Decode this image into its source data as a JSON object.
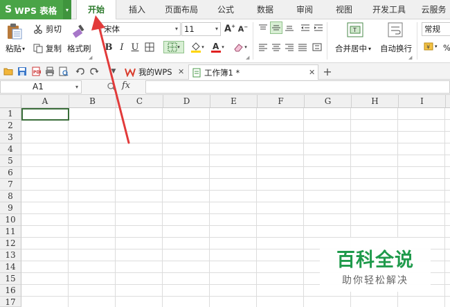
{
  "app": {
    "logo_mark": "S",
    "logo_text": "WPS 表格",
    "logo_dropdown": "▾"
  },
  "menu": {
    "tabs": [
      {
        "label": "开始",
        "active": true
      },
      {
        "label": "插入"
      },
      {
        "label": "页面布局"
      },
      {
        "label": "公式"
      },
      {
        "label": "数据"
      },
      {
        "label": "审阅"
      },
      {
        "label": "视图"
      },
      {
        "label": "开发工具"
      },
      {
        "label": "云服务"
      }
    ]
  },
  "ribbon": {
    "paste_label": "粘贴",
    "cut_label": "剪切",
    "copy_label": "复制",
    "format_painter_label": "格式刷",
    "font_name": "宋体",
    "font_size": "11",
    "bold": "B",
    "italic": "I",
    "underline": "U",
    "merge_center_label": "合并居中",
    "wrap_text_label": "自动换行",
    "number_format": "常规",
    "percent": "%"
  },
  "doc_tabs": [
    {
      "label": "我的WPS",
      "active": false
    },
    {
      "label": "工作簿1 *",
      "active": true
    }
  ],
  "formula_bar": {
    "cell_ref": "A1",
    "fx": "fx",
    "value": ""
  },
  "grid": {
    "columns": [
      "A",
      "B",
      "C",
      "D",
      "E",
      "F",
      "G",
      "H",
      "I"
    ],
    "rows": [
      "1",
      "2",
      "3",
      "4",
      "5",
      "6",
      "7",
      "8",
      "9",
      "10",
      "11",
      "12",
      "13",
      "14",
      "15",
      "16",
      "17"
    ]
  },
  "watermark": {
    "title": "百科全说",
    "subtitle": "助你轻松解决"
  },
  "colors": {
    "accent": "#4aa447",
    "annotation": "#e23a3a",
    "watermark": "#1f9a4b"
  }
}
